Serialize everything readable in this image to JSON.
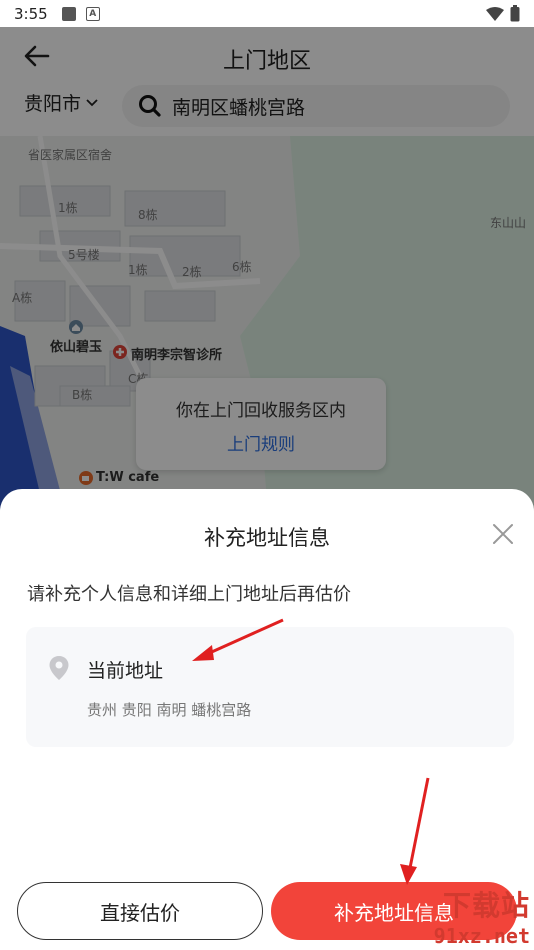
{
  "status_bar": {
    "time": "3:55"
  },
  "header": {
    "title": "上门地区",
    "city": "贵阳市",
    "search_value": "南明区蟠桃宫路"
  },
  "map": {
    "labels": {
      "top_left": "省医家属区宿舍",
      "b1": "1栋",
      "b8": "8栋",
      "b5": "5号楼",
      "b1b": "1栋",
      "b2": "2栋",
      "b6": "6栋",
      "ba": "A栋",
      "bc": "C栋",
      "bb": "B栋",
      "east": "东山山"
    },
    "pois": {
      "yishan": "依山碧玉",
      "clinic": "南明李宗智诊所",
      "cafe": "T:W cafe"
    },
    "tooltip": {
      "text": "你在上门回收服务区内",
      "link": "上门规则"
    }
  },
  "sheet": {
    "title": "补充地址信息",
    "description": "请补充个人信息和详细上门地址后再估价",
    "address_label": "当前地址",
    "address_detail": "贵州 贵阳 南明 蟠桃宫路",
    "direct_button": "直接估价",
    "supplement_button": "补充地址信息"
  },
  "watermark": {
    "top": "下载站",
    "bottom": "91xz.net"
  },
  "colors": {
    "accent": "#f2443a",
    "link": "#2f6fe0"
  }
}
